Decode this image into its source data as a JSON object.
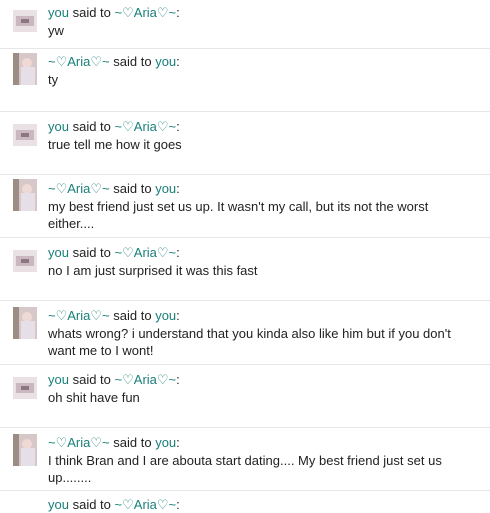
{
  "accent_color": "#1a7f79",
  "messages": [
    {
      "from": "you",
      "to": "~♡Aria♡~",
      "said": "said to",
      "text": "yw"
    },
    {
      "from": "~♡Aria♡~",
      "to": "you",
      "said": "said to",
      "text": "ty"
    },
    {
      "from": "you",
      "to": "~♡Aria♡~",
      "said": "said to",
      "text": "true tell me how it goes"
    },
    {
      "from": "~♡Aria♡~",
      "to": "you",
      "said": "said to",
      "text": "my best friend just set us up. It wasn't my call, but its not the worst either...."
    },
    {
      "from": "you",
      "to": "~♡Aria♡~",
      "said": "said to",
      "text": "no I am just surprised it was this fast"
    },
    {
      "from": "~♡Aria♡~",
      "to": "you",
      "said": "said to",
      "text": "whats wrong? i understand that you kinda also like him but if you don't want me to I wont!"
    },
    {
      "from": "you",
      "to": "~♡Aria♡~",
      "said": "said to",
      "text": "oh shit have fun"
    },
    {
      "from": "~♡Aria♡~",
      "to": "you",
      "said": "said to",
      "text": "I think Bran and I are abouta start dating.... My best friend just set us up........"
    },
    {
      "from": "you",
      "to": "~♡Aria♡~",
      "said": "said to",
      "text": ""
    }
  ]
}
